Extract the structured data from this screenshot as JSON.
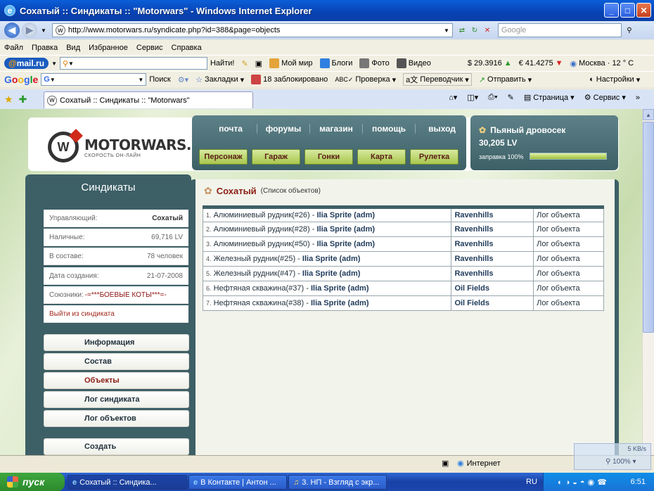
{
  "browser": {
    "title": "Сохатый :: Синдикаты :: \"Motorwars\" - Windows Internet Explorer",
    "url": "http://www.motorwars.ru/syndicate.php?id=388&page=objects",
    "search_placeholder": "Google",
    "menu": [
      "Файл",
      "Правка",
      "Вид",
      "Избранное",
      "Сервис",
      "Справка"
    ],
    "find_label": "Найти!",
    "mailru_items": [
      "Мой мир",
      "Блоги",
      "Фото",
      "Видео"
    ],
    "usd": "$ 29.3916",
    "eur": "€ 41.4275",
    "weather": "Москва · 12 ° C",
    "google_toolbar": {
      "search": "Поиск",
      "bookmarks": "Закладки",
      "blocked": "18 заблокировано",
      "spell": "Проверка",
      "translate": "Переводчик",
      "send": "Отправить",
      "settings": "Настройки"
    },
    "tab_title": "Сохатый :: Синдикаты :: \"Motorwars\"",
    "cmd_page": "Страница",
    "cmd_tools": "Сервис",
    "status_zone": "Интернет",
    "zoom": "100%",
    "speed": "5 KB/s"
  },
  "site": {
    "logo_text": "MOTORWARS.RU",
    "logo_sub": "СКОРОСТЬ ОН-ЛАЙН",
    "nav_links": [
      "почта",
      "форумы",
      "магазин",
      "помощь",
      "выход"
    ],
    "nav_buttons": [
      "Персонаж",
      "Гараж",
      "Гонки",
      "Карта",
      "Рулетка"
    ],
    "user": {
      "name": "Пьяный дровосек",
      "balance": "30,205 LV",
      "fuel_label": "заправка 100%",
      "fuel_level": 1.0
    }
  },
  "sidebar": {
    "title": "Синдикаты",
    "manager_label": "Управляющий:",
    "manager_value": "Сохатый",
    "cash_label": "Наличные:",
    "cash_value": "69,716 LV",
    "members_label": "В составе:",
    "members_value": "78 человек",
    "created_label": "Дата создания:",
    "created_value": "21-07-2008",
    "allies_label": "Союзники:",
    "allies_value": "-=***БОЕВЫЕ КОТЫ***=-",
    "exit_label": "Выйти из синдиката",
    "menu": [
      "Информация",
      "Состав",
      "Объекты",
      "Лог синдиката",
      "Лог объектов",
      "Создать"
    ]
  },
  "main": {
    "title": "Сохатый",
    "subtitle": "(Список объектов)",
    "objects": [
      {
        "num": "1.",
        "name": "Алюминиевый рудник(#26) -",
        "owner": "Ilia Sprite (adm)",
        "location": "Ravenhills",
        "log": "Лог объекта"
      },
      {
        "num": "2.",
        "name": "Алюминиевый рудник(#28) -",
        "owner": "Ilia Sprite (adm)",
        "location": "Ravenhills",
        "log": "Лог объекта"
      },
      {
        "num": "3.",
        "name": "Алюминиевый рудник(#50) -",
        "owner": "Ilia Sprite (adm)",
        "location": "Ravenhills",
        "log": "Лог объекта"
      },
      {
        "num": "4.",
        "name": "Железный рудник(#25) -",
        "owner": "Ilia Sprite (adm)",
        "location": "Ravenhills",
        "log": "Лог объекта"
      },
      {
        "num": "5.",
        "name": "Железный рудник(#47) -",
        "owner": "Ilia Sprite (adm)",
        "location": "Ravenhills",
        "log": "Лог объекта"
      },
      {
        "num": "6.",
        "name": "Нефтяная скважина(#37) -",
        "owner": "Ilia Sprite (adm)",
        "location": "Oil Fields",
        "log": "Лог объекта"
      },
      {
        "num": "7.",
        "name": "Нефтяная скважина(#38) -",
        "owner": "Ilia Sprite (adm)",
        "location": "Oil Fields",
        "log": "Лог объекта"
      }
    ]
  },
  "taskbar": {
    "start": "пуск",
    "items": [
      "Сохатый :: Синдика...",
      "В Контакте | Антон ...",
      "3. НП - Взгляд с экр..."
    ],
    "lang": "RU",
    "clock": "6:51"
  }
}
